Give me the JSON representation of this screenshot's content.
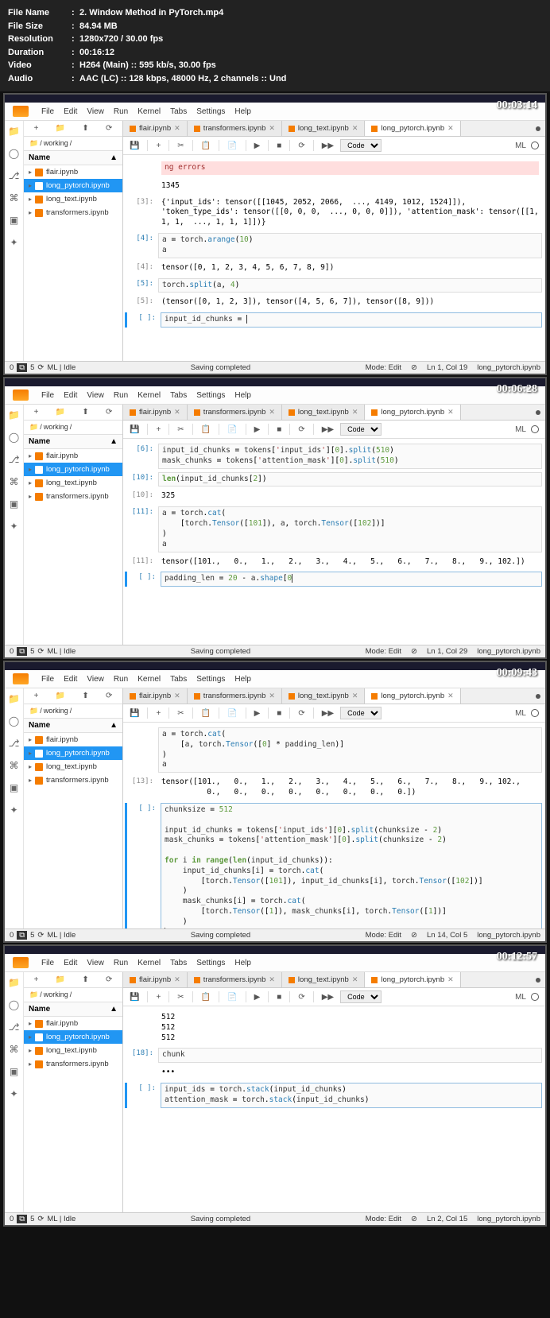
{
  "meta": {
    "file_name_label": "File Name",
    "file_name": "2. Window Method in PyTorch.mp4",
    "file_size_label": "File Size",
    "file_size": "84.94 MB",
    "resolution_label": "Resolution",
    "resolution": "1280x720 / 30.00 fps",
    "duration_label": "Duration",
    "duration": "00:16:12",
    "video_label": "Video",
    "video": "H264 (Main) :: 595 kb/s, 30.00 fps",
    "audio_label": "Audio",
    "audio": "AAC (LC) :: 128 kbps, 48000 Hz, 2 channels :: Und"
  },
  "menus": [
    "File",
    "Edit",
    "View",
    "Run",
    "Kernel",
    "Tabs",
    "Settings",
    "Help"
  ],
  "file_toolbar_icons": [
    "+",
    "📁",
    "⬆",
    "⟳"
  ],
  "breadcrumb": [
    "📁",
    "/",
    "working",
    "/"
  ],
  "name_header": "Name",
  "files": [
    {
      "name": "flair.ipynb",
      "selected": false
    },
    {
      "name": "long_pytorch.ipynb",
      "selected": true
    },
    {
      "name": "long_text.ipynb",
      "selected": false
    },
    {
      "name": "transformers.ipynb",
      "selected": false
    }
  ],
  "tabs": [
    {
      "label": "flair.ipynb",
      "active": false
    },
    {
      "label": "transformers.ipynb",
      "active": false
    },
    {
      "label": "long_text.ipynb",
      "active": false
    },
    {
      "label": "long_pytorch.ipynb",
      "active": true
    }
  ],
  "nb_toolbar": {
    "icons": [
      "💾",
      "+",
      "✂",
      "📋",
      "📄",
      "▶",
      "■",
      "⟳",
      "▶▶"
    ],
    "cell_type": "Code",
    "kernel_label": "ML"
  },
  "status": {
    "left_nums": "5",
    "left_mode": "ML | Idle",
    "center": "Saving completed",
    "mode": "Mode: Edit",
    "file": "long_pytorch.ipynb"
  },
  "shots": [
    {
      "timestamp": "00:03:14",
      "lncol": "Ln 1, Col 19",
      "cells": [
        {
          "type": "err",
          "prompt": "",
          "text": "ng errors"
        },
        {
          "type": "out",
          "prompt": "",
          "text": "1345"
        },
        {
          "type": "out",
          "prompt": "[3]:",
          "text": "{'input_ids': tensor([[1045, 2052, 2066,  ..., 4149, 1012, 1524]]), 'token_type_ids': tensor([[0, 0, 0,  ..., 0, 0, 0]]), 'attention_mask': tensor([[1, 1, 1,  ..., 1, 1, 1]])}"
        },
        {
          "type": "in",
          "prompt": "[4]:",
          "text": "a = torch.arange(10)\na"
        },
        {
          "type": "out",
          "prompt": "[4]:",
          "text": "tensor([0, 1, 2, 3, 4, 5, 6, 7, 8, 9])"
        },
        {
          "type": "in",
          "prompt": "[5]:",
          "text": "torch.split(a, 4)"
        },
        {
          "type": "out",
          "prompt": "[5]:",
          "text": "(tensor([0, 1, 2, 3]), tensor([4, 5, 6, 7]), tensor([8, 9]))"
        },
        {
          "type": "edit",
          "prompt": "[ ]:",
          "text": "input_id_chunks = |"
        }
      ]
    },
    {
      "timestamp": "00:06:28",
      "lncol": "Ln 1, Col 29",
      "cells": [
        {
          "type": "in",
          "prompt": "[6]:",
          "text": "input_id_chunks = tokens['input_ids'][0].split(510)\nmask_chunks = tokens['attention_mask'][0].split(510)"
        },
        {
          "type": "in",
          "prompt": "[10]:",
          "text": "len(input_id_chunks[2])"
        },
        {
          "type": "out",
          "prompt": "[10]:",
          "text": "325"
        },
        {
          "type": "in",
          "prompt": "[11]:",
          "text": "a = torch.cat(\n    [torch.Tensor([101]), a, torch.Tensor([102])]\n)\na"
        },
        {
          "type": "out",
          "prompt": "[11]:",
          "text": "tensor([101.,   0.,   1.,   2.,   3.,   4.,   5.,   6.,   7.,   8.,   9., 102.])"
        },
        {
          "type": "edit",
          "prompt": "[ ]:",
          "text": "padding_len = 20 - a.shape[0|"
        }
      ]
    },
    {
      "timestamp": "00:09:43",
      "lncol": "Ln 14, Col 5",
      "cells": [
        {
          "type": "in",
          "prompt": "",
          "text": "a = torch.cat(\n    [a, torch.Tensor([0] * padding_len)]\n)\na"
        },
        {
          "type": "out",
          "prompt": "[13]:",
          "text": "tensor([101.,   0.,   1.,   2.,   3.,   4.,   5.,   6.,   7.,   8.,   9., 102.,\n          0.,   0.,   0.,   0.,   0.,   0.,   0.,   0.])"
        },
        {
          "type": "edit",
          "prompt": "[ ]:",
          "text": "chunksize = 512\n\ninput_id_chunks = tokens['input_ids'][0].split(chunksize - 2)\nmask_chunks = tokens['attention_mask'][0].split(chunksize - 2)\n\nfor i in range(len(input_id_chunks)):\n    input_id_chunks[i] = torch.cat(\n        [torch.Tensor([101]), input_id_chunks[i], torch.Tensor([102])]\n    )\n    mask_chunks[i] = torch.cat(\n        [torch.Tensor([1]), mask_chunks[i], torch.Tensor([1])]\n    )\n|"
        }
      ]
    },
    {
      "timestamp": "00:12:57",
      "lncol": "Ln 2, Col 15",
      "cells": [
        {
          "type": "out",
          "prompt": "",
          "text": "512\n512\n512"
        },
        {
          "type": "in",
          "prompt": "[18]:",
          "text": "chunk"
        },
        {
          "type": "out",
          "prompt": "",
          "text": "•••"
        },
        {
          "type": "edit",
          "prompt": "[ ]:",
          "text": "input_ids = torch.stack(input_id_chunks)\nattention_mask = torch.stack(input_id_chunks)"
        }
      ]
    }
  ]
}
